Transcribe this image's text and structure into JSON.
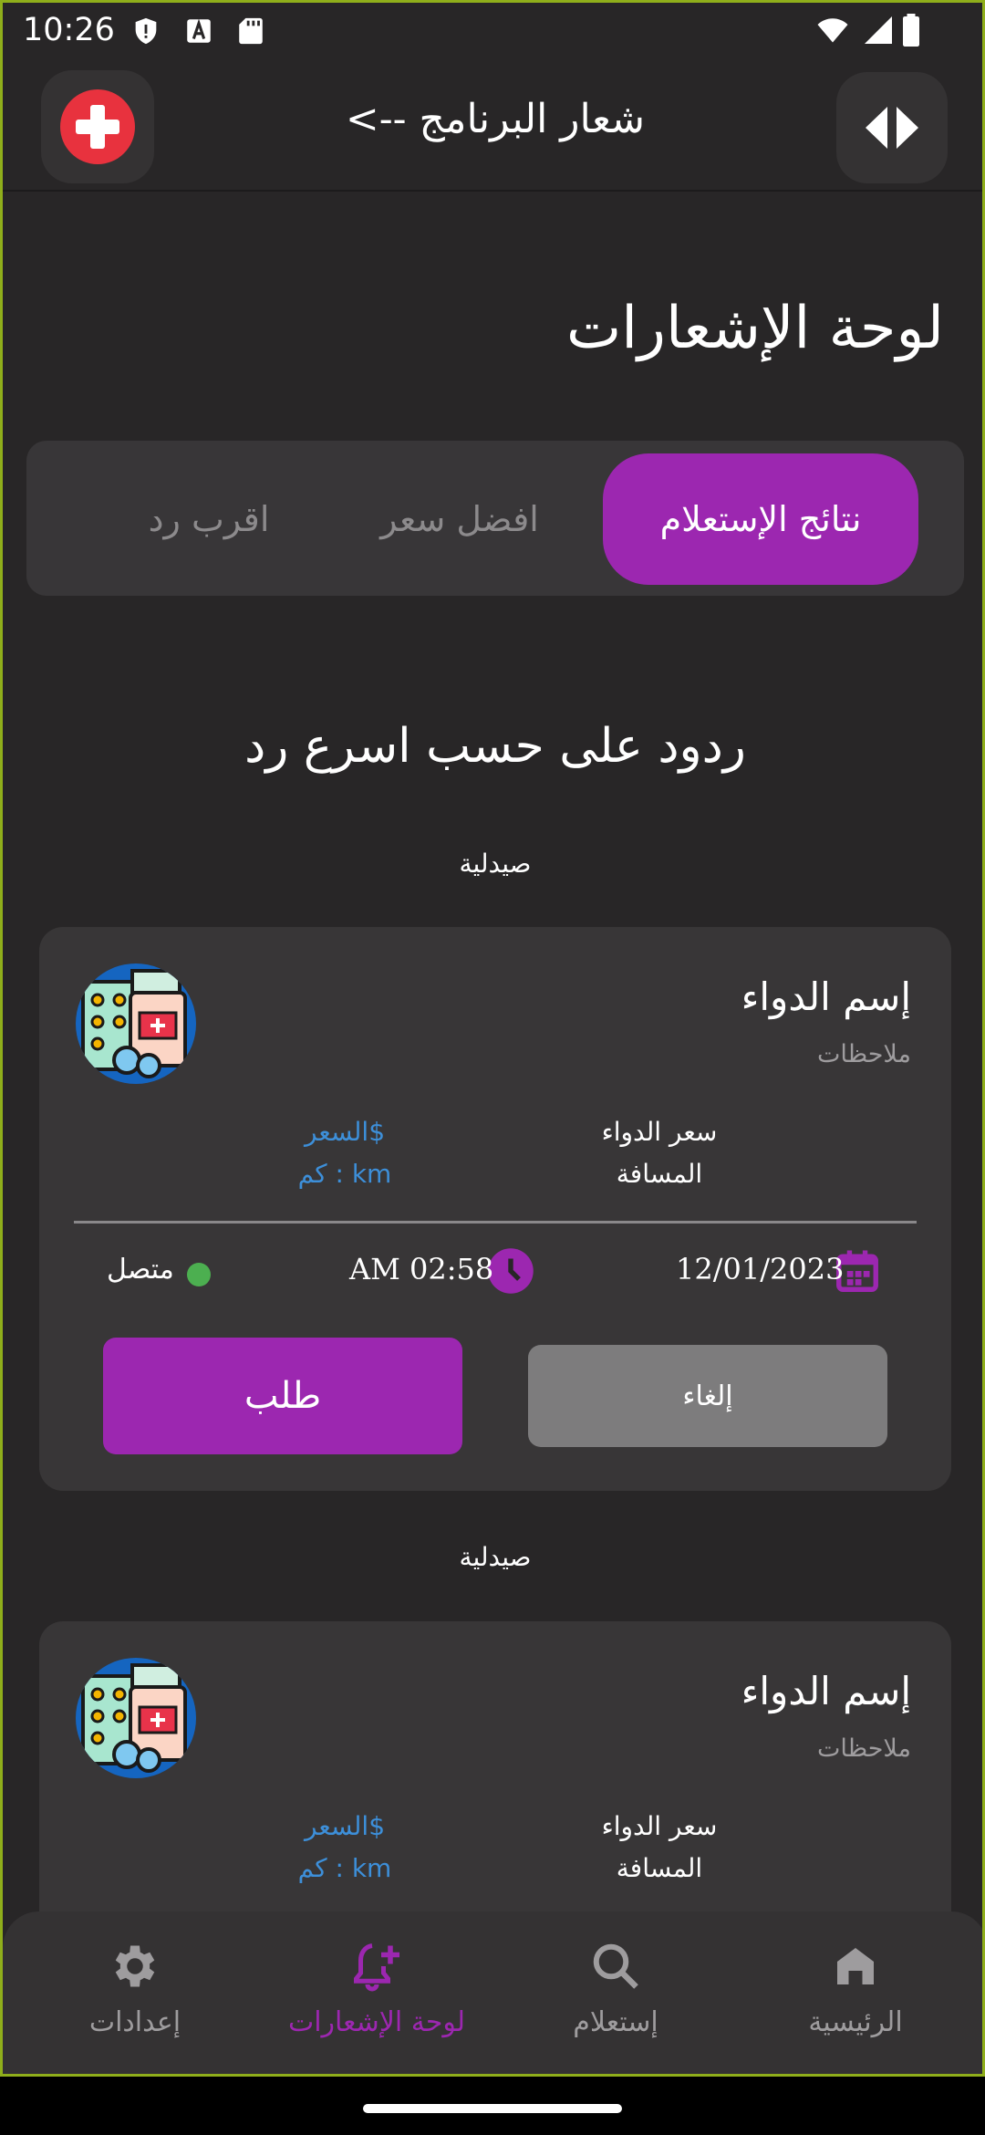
{
  "status_bar": {
    "time": "10:26"
  },
  "app_bar": {
    "title": "شعار البرنامج -->"
  },
  "page_title": "لوحة الإشعارات",
  "tabs": [
    {
      "label": "نتائج الإستعلام",
      "active": true
    },
    {
      "label": "افضل سعر",
      "active": false
    },
    {
      "label": "اقرب رد",
      "active": false
    }
  ],
  "section_heading": "ردود على حسب اسرع رد",
  "cards": [
    {
      "pharmacy": "صيدلية",
      "medicine_name": "إسم الدواء",
      "notes": "ملاحظات",
      "price_label": "سعر الدواء",
      "price_value": "$السعر",
      "distance_label": "المسافة",
      "distance_value": "km : كم",
      "date": "12/01/2023",
      "time": "AM 02:58",
      "status": "متصل",
      "request_label": "طلب",
      "cancel_label": "إلغاء"
    },
    {
      "pharmacy": "صيدلية",
      "medicine_name": "إسم الدواء",
      "notes": "ملاحظات",
      "price_label": "سعر الدواء",
      "price_value": "$السعر",
      "distance_label": "المسافة",
      "distance_value": "km : كم"
    }
  ],
  "bottom_nav": [
    {
      "label": "إعدادات",
      "icon": "gear-icon",
      "active": false
    },
    {
      "label": "لوحة الإشعارات",
      "icon": "bell-plus-icon",
      "active": true
    },
    {
      "label": "إستعلام",
      "icon": "search-icon",
      "active": false
    },
    {
      "label": "الرئيسية",
      "icon": "home-icon",
      "active": false
    }
  ],
  "colors": {
    "accent": "#9c27b0",
    "background": "#282627",
    "card": "#383637",
    "link_blue": "#3d8fd9",
    "online_green": "#4caf50"
  }
}
